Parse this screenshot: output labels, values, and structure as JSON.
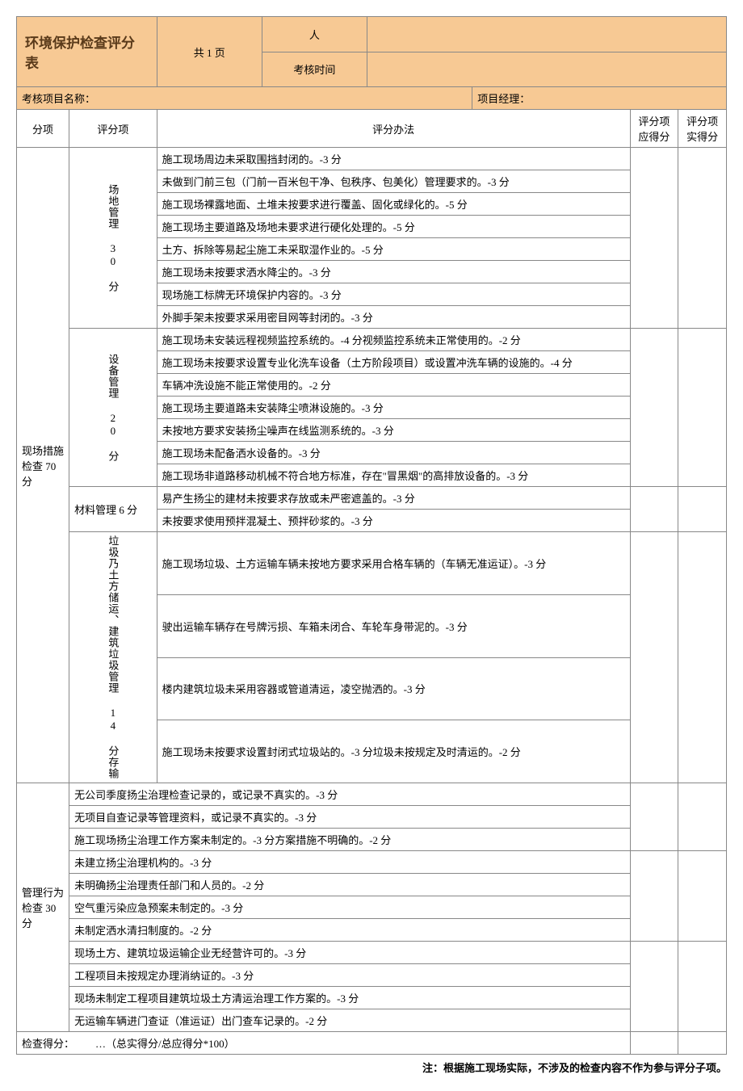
{
  "header": {
    "title": "环境保护检查评分表",
    "page_info": "共 1 页",
    "person_label": "人",
    "time_label": "考核时间",
    "project_name_label": "考核项目名称：",
    "manager_label": "项目经理：",
    "col_category": "分项",
    "col_subitem": "评分项",
    "col_method": "评分办法",
    "col_score_should": "评分项应得分",
    "col_score_actual": "评分项实得分"
  },
  "cat1": {
    "label": "现场措施检查 70 分"
  },
  "cat2": {
    "label": "管理行为检查 30 分"
  },
  "sub1": {
    "label": "场地管理 30 分"
  },
  "sub2": {
    "label": "设备管理 20 分"
  },
  "sub3": {
    "label": "材料管理 6 分"
  },
  "sub4": {
    "label": "垃圾乃土方储运、建筑垃圾管理 14 分存输"
  },
  "rows": {
    "r1": "施工现场周边未采取围挡封闭的。-3 分",
    "r2": "未做到门前三包（门前一百米包干净、包秩序、包美化）管理要求的。-3 分",
    "r3": "施工现场裸露地面、土堆未按要求进行覆盖、固化或绿化的。-5 分",
    "r4": "施工现场主要道路及场地未要求进行硬化处理的。-5 分",
    "r5": "土方、拆除等易起尘施工未采取湿作业的。-5 分",
    "r6": "施工现场未按要求洒水降尘的。-3 分",
    "r7": "现场施工标牌无环境保护内容的。-3 分",
    "r8": "外脚手架未按要求采用密目网等封闭的。-3 分",
    "r9": "施工现场未安装远程视频监控系统的。-4 分视频监控系统未正常使用的。-2 分",
    "r10": "施工现场未按要求设置专业化洗车设备（土方阶段项目）或设置冲洗车辆的设施的。-4 分",
    "r11": "车辆冲洗设施不能正常使用的。-2 分",
    "r12": "施工现场主要道路未安装降尘喷淋设施的。-3 分",
    "r13": "未按地方要求安装扬尘噪声在线监测系统的。-3 分",
    "r14": "施工现场未配备洒水设备的。-3 分",
    "r15": "施工现场非道路移动机械不符合地方标准，存在\"冒黑烟\"的高排放设备的。-3 分",
    "r16": "易产生扬尘的建材未按要求存放或未严密遮盖的。-3 分",
    "r17": "未按要求使用预拌混凝土、预拌砂浆的。-3 分",
    "r18": "施工现场垃圾、土方运输车辆未按地方要求采用合格车辆的（车辆无准运证）。-3 分",
    "r19": "驶出运输车辆存在号牌污损、车箱未闭合、车轮车身带泥的。-3 分",
    "r20": "楼内建筑垃圾未采用容器或管道清运，凌空抛洒的。-3 分",
    "r21": "施工现场未按要求设置封闭式垃圾站的。-3 分垃圾未按规定及时清运的。-2 分",
    "m1": "无公司季度扬尘治理检查记录的，或记录不真实的。-3 分",
    "m2": "无项目自查记录等管理资料，或记录不真实的。-3 分",
    "m3": "施工现场扬尘治理工作方案未制定的。-3 分方案措施不明确的。-2 分",
    "m4": "未建立扬尘治理机构的。-3 分",
    "m5": "未明确扬尘治理责任部门和人员的。-2 分",
    "m6": "空气重污染应急预案未制定的。-3 分",
    "m7": "未制定洒水清扫制度的。-2 分",
    "m8": "现场土方、建筑垃圾运输企业无经营许可的。-3 分",
    "m9": "工程项目未按规定办理消纳证的。-3 分",
    "m10": "现场未制定工程项目建筑垃圾土方清运治理工作方案的。-3 分",
    "m11": "无运输车辆进门查证（准运证）出门查车记录的。-2 分"
  },
  "footer": {
    "check_score_label": "检查得分：",
    "formula": "…（总实得分/总应得分*100）",
    "note": "注：根据施工现场实际，不涉及的检查内容不作为参与评分子项。"
  }
}
